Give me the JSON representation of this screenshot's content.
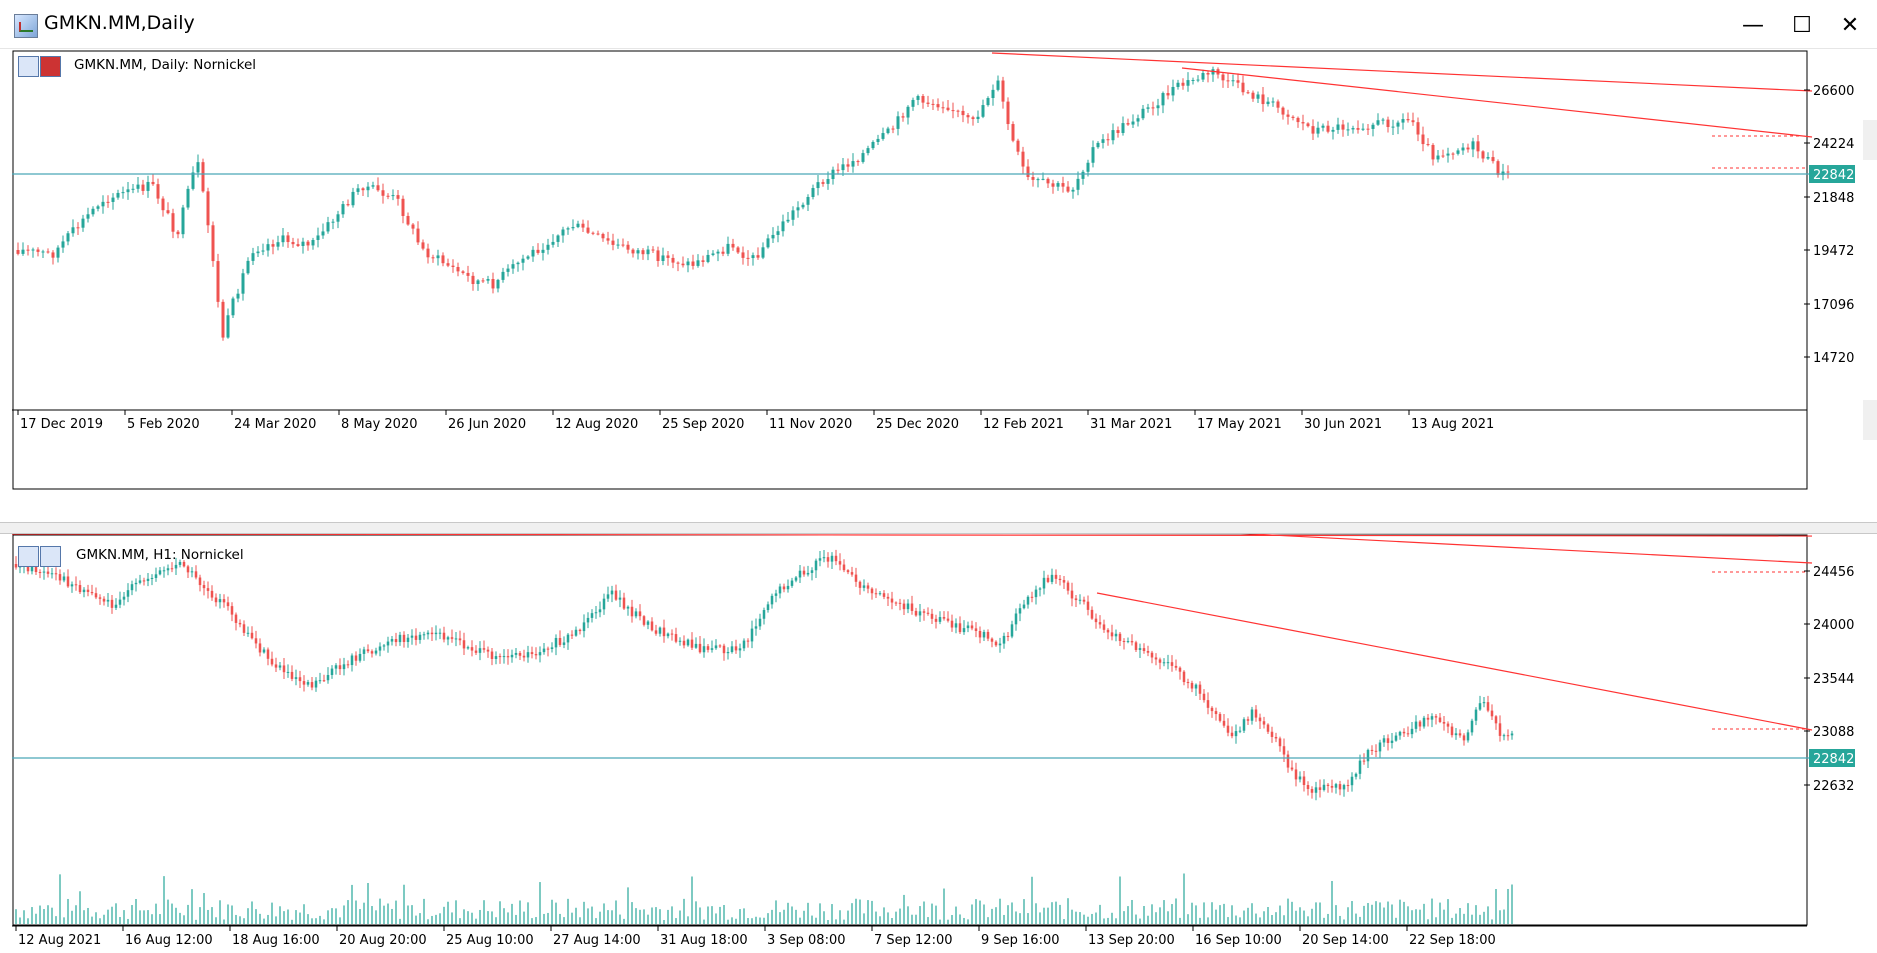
{
  "window": {
    "title": "GMKN.MM,Daily",
    "controls": {
      "minimize": "—",
      "maximize": "☐",
      "close": "✕"
    }
  },
  "colors": {
    "bull": "#26a69a",
    "bear": "#ef5350",
    "trend": "#ff3333",
    "price_line": "#4aa8b8",
    "price_tag": "#26a69a"
  },
  "top_chart": {
    "label": "GMKN.MM, Daily:  Nornickel",
    "price_ticks": [
      "26600",
      "24224",
      "21848",
      "19472",
      "17096",
      "14720"
    ],
    "current_price": "22842",
    "date_ticks": [
      "17 Dec 2019",
      "5 Feb 2020",
      "24 Mar 2020",
      "8 May 2020",
      "26 Jun 2020",
      "12 Aug 2020",
      "25 Sep 2020",
      "11 Nov 2020",
      "25 Dec 2020",
      "12 Feb 2021",
      "31 Mar 2021",
      "17 May 2021",
      "30 Jun 2021",
      "13 Aug 2021"
    ]
  },
  "bottom_chart": {
    "label": "GMKN.MM, H1:  Nornickel",
    "price_ticks": [
      "24456",
      "24000",
      "23544",
      "23088",
      "22632"
    ],
    "current_price": "22842",
    "date_ticks": [
      "12 Aug 2021",
      "16 Aug 12:00",
      "18 Aug 16:00",
      "20 Aug 20:00",
      "25 Aug 10:00",
      "27 Aug 14:00",
      "31 Aug 18:00",
      "3 Sep 08:00",
      "7 Sep 12:00",
      "9 Sep 16:00",
      "13 Sep 20:00",
      "16 Sep 10:00",
      "20 Sep 14:00",
      "22 Sep 18:00"
    ]
  }
}
